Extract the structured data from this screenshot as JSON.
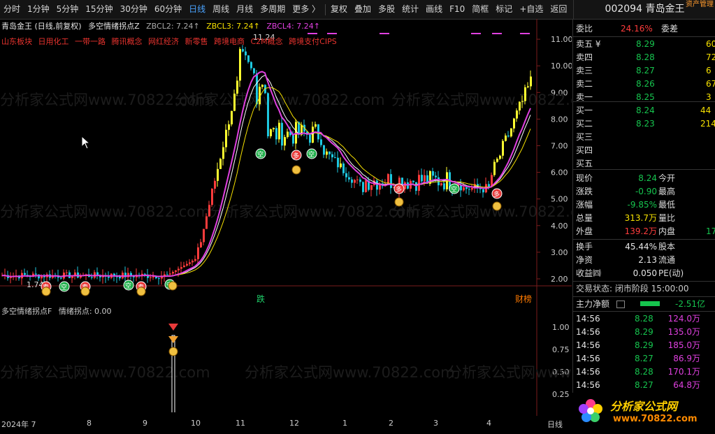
{
  "toolbar": {
    "items": [
      "分时",
      "1分钟",
      "5分钟",
      "15分钟",
      "30分钟",
      "60分钟",
      "日线",
      "周线",
      "月线",
      "多周期",
      "更多 〉",
      "复权",
      "叠加",
      "多股",
      "统计",
      "画线",
      "F10",
      "简框",
      "标记",
      "+自选",
      "返回"
    ],
    "active": "日线",
    "code_title": "002094 青岛金王",
    "asset_mgmt": "资产管理"
  },
  "chart": {
    "title": "青岛金王 (日线,前复权)",
    "indicator_name": "多空情绪拐点Z",
    "zbcl2": "ZBCL2: 7.24↑",
    "zbcl3": "ZBCL3: 7.24↑",
    "zbcl4": "ZBCL4: 7.24↑",
    "concepts": [
      "山东板块",
      "日用化工",
      "一带一路",
      "腾讯概念",
      "网红经济",
      "新零售",
      "跨境电商",
      "C2M概念",
      "跨境支付CIPS"
    ],
    "price_axis": [
      "11.00",
      "10.00",
      "9.00",
      "8.00",
      "7.00",
      "6.00",
      "5.00",
      "4.00",
      "3.00",
      "2.00"
    ],
    "high_label": "11.24",
    "low_label": "1.74",
    "die_label": "跌",
    "cai_label": "财榜",
    "sub_indicator": "多空情绪拐点F",
    "sub_value": "情绪拐点: 0.00",
    "sub_axis": [
      "1.00",
      "0.75",
      "0.50",
      "0.25"
    ],
    "dates": [
      "2024年 7",
      "8",
      "9",
      "10",
      "11",
      "12",
      "1",
      "2",
      "3",
      "4"
    ],
    "period": "日线",
    "watermark": "分析家公式网www.70822.com"
  },
  "quote": {
    "weibi_label": "委比",
    "weibi": "24.16%",
    "weicha_label": "委差",
    "asks": [
      {
        "label": "卖五 ¥",
        "price": "8.29",
        "vol": "60"
      },
      {
        "label": "卖四",
        "price": "8.28",
        "vol": "72"
      },
      {
        "label": "卖三",
        "price": "8.27",
        "vol": "6"
      },
      {
        "label": "卖二",
        "price": "8.26",
        "vol": "67"
      },
      {
        "label": "卖一",
        "price": "8.25",
        "vol": "3"
      }
    ],
    "bids": [
      {
        "label": "买一",
        "price": "8.24",
        "vol": "44"
      },
      {
        "label": "买二",
        "price": "8.23",
        "vol": "214"
      },
      {
        "label": "买三",
        "price": "",
        "vol": ""
      },
      {
        "label": "买四",
        "price": "",
        "vol": ""
      },
      {
        "label": "买五",
        "price": "",
        "vol": ""
      }
    ],
    "stats": [
      {
        "l1": "现价",
        "v1": "8.24",
        "c1": "green",
        "l2": "今开"
      },
      {
        "l1": "涨跌",
        "v1": "-0.90",
        "c1": "green",
        "l2": "最高"
      },
      {
        "l1": "涨幅",
        "v1": "-9.85%",
        "c1": "green",
        "l2": "最低"
      },
      {
        "l1": "总量",
        "v1": "313.7万",
        "c1": "yellow",
        "l2": "量比"
      },
      {
        "l1": "外盘",
        "v1": "139.2万",
        "c1": "red",
        "l2": "内盘",
        "v2": "17"
      }
    ],
    "fund": [
      {
        "l1": "换手",
        "v1": "45.44%",
        "l2": "股本"
      },
      {
        "l1": "净资",
        "v1": "2.13",
        "l2": "流通"
      },
      {
        "l1": "收益㈣",
        "v1": "0.050",
        "l2": "PE(动)"
      }
    ],
    "trade_status": "交易状态: 闭市阶段 15:00:00",
    "main_flow_label": "主力净额",
    "main_flow_value": "-2.51亿",
    "ticks": [
      {
        "t": "14:56",
        "p": "8.28",
        "v": "124.0万"
      },
      {
        "t": "14:56",
        "p": "8.29",
        "v": "135.0万"
      },
      {
        "t": "14:56",
        "p": "8.29",
        "v": "185.0万"
      },
      {
        "t": "14:56",
        "p": "8.27",
        "v": "86.9万"
      },
      {
        "t": "14:56",
        "p": "8.28",
        "v": "170.1万"
      },
      {
        "t": "14:56",
        "p": "8.27",
        "v": "64.8万"
      }
    ]
  },
  "logo": {
    "text": "分析家公式网",
    "url": "www.70822.com"
  }
}
